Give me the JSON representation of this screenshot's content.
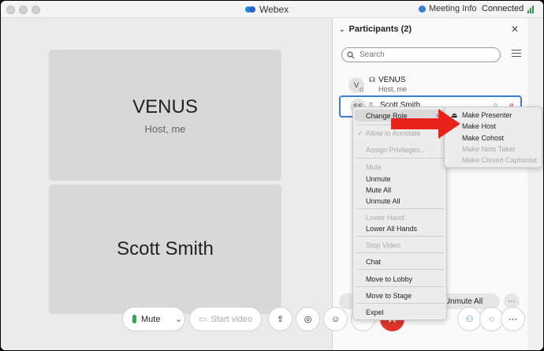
{
  "app": {
    "title": "Webex",
    "meeting_info": "Meeting Info",
    "status": "Connected"
  },
  "tiles": {
    "venus": {
      "name": "VENUS",
      "sub": "Host, me"
    },
    "scott": {
      "name": "Scott Smith"
    }
  },
  "panel": {
    "title": "Participants (2)",
    "search_placeholder": "Search",
    "participants": [
      {
        "initials": "V",
        "name": "VENUS",
        "sub": "Host, me"
      },
      {
        "initials": "SS",
        "name": "Scott Smith"
      }
    ],
    "unmute_all": "Unmute All"
  },
  "controls": {
    "mute": "Mute",
    "start_video": "Start video",
    "end": "✕"
  },
  "context_menu": {
    "items": [
      {
        "label": "Change Role",
        "state": "highlighted"
      },
      {
        "label": "Allow to Annotate",
        "state": "disabled"
      },
      {
        "label": "Assign Privileges...",
        "state": "disabled"
      },
      {
        "label": "Mute",
        "state": "disabled"
      },
      {
        "label": "Unmute",
        "state": "enabled"
      },
      {
        "label": "Mute All",
        "state": "enabled"
      },
      {
        "label": "Unmute All",
        "state": "enabled"
      },
      {
        "label": "Lower Hand",
        "state": "disabled"
      },
      {
        "label": "Lower All Hands",
        "state": "enabled"
      },
      {
        "label": "Stop Video",
        "state": "disabled"
      },
      {
        "label": "Chat",
        "state": "enabled"
      },
      {
        "label": "Move to Lobby",
        "state": "enabled"
      },
      {
        "label": "Move to Stage",
        "state": "enabled"
      },
      {
        "label": "Expel",
        "state": "enabled"
      }
    ]
  },
  "role_submenu": {
    "items": [
      {
        "label": "Make Presenter",
        "state": "enabled"
      },
      {
        "label": "Make Host",
        "state": "enabled"
      },
      {
        "label": "Make Cohost",
        "state": "enabled"
      },
      {
        "label": "Make Note Taker",
        "state": "disabled"
      },
      {
        "label": "Make Closed Captionist",
        "state": "disabled"
      }
    ]
  },
  "colors": {
    "accent": "#3a7fd5",
    "end_call": "#e0342b",
    "annotation_arrow": "#e8231c"
  }
}
